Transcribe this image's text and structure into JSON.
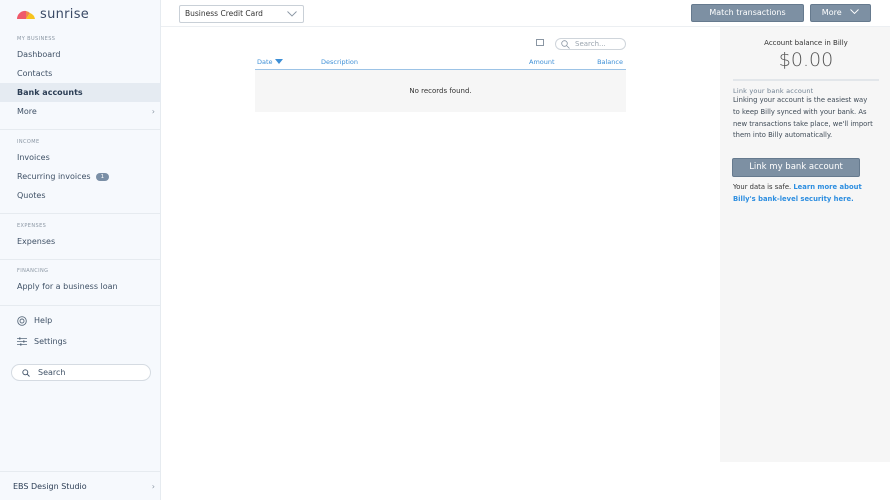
{
  "brand": {
    "name": "sunrise"
  },
  "sidebar": {
    "sections": [
      {
        "title": "MY BUSINESS",
        "items": [
          {
            "label": "Dashboard"
          },
          {
            "label": "Contacts"
          },
          {
            "label": "Bank accounts"
          },
          {
            "label": "More"
          }
        ]
      },
      {
        "title": "INCOME",
        "items": [
          {
            "label": "Invoices"
          },
          {
            "label": "Recurring invoices",
            "badge": "1"
          },
          {
            "label": "Quotes"
          }
        ]
      },
      {
        "title": "EXPENSES",
        "items": [
          {
            "label": "Expenses"
          }
        ]
      },
      {
        "title": "FINANCING",
        "items": [
          {
            "label": "Apply for a business loan"
          }
        ]
      }
    ],
    "help": "Help",
    "settings": "Settings",
    "search_placeholder": "Search",
    "org": "EBS Design Studio"
  },
  "topbar": {
    "account_select": "Business Credit Card",
    "match": "Match transactions",
    "more": "More"
  },
  "table": {
    "search_placeholder": "Search...",
    "columns": [
      "Date",
      "Description",
      "Amount",
      "Balance"
    ],
    "empty": "No records found."
  },
  "panel": {
    "balance_label": "Account balance in Billy",
    "balance": "$0.00",
    "link_title": "Link your bank account",
    "link_text": "Linking your account is the easiest way to keep Billy synced with your bank. As new transactions take place, we'll import them into Billy automatically.",
    "link_button": "Link my bank account",
    "safe": "Your data is safe.",
    "learn_more": "Learn more about Billy's bank-level security here."
  },
  "colors": {
    "accent": "#3d8fd6",
    "button": "#7d90a3"
  }
}
